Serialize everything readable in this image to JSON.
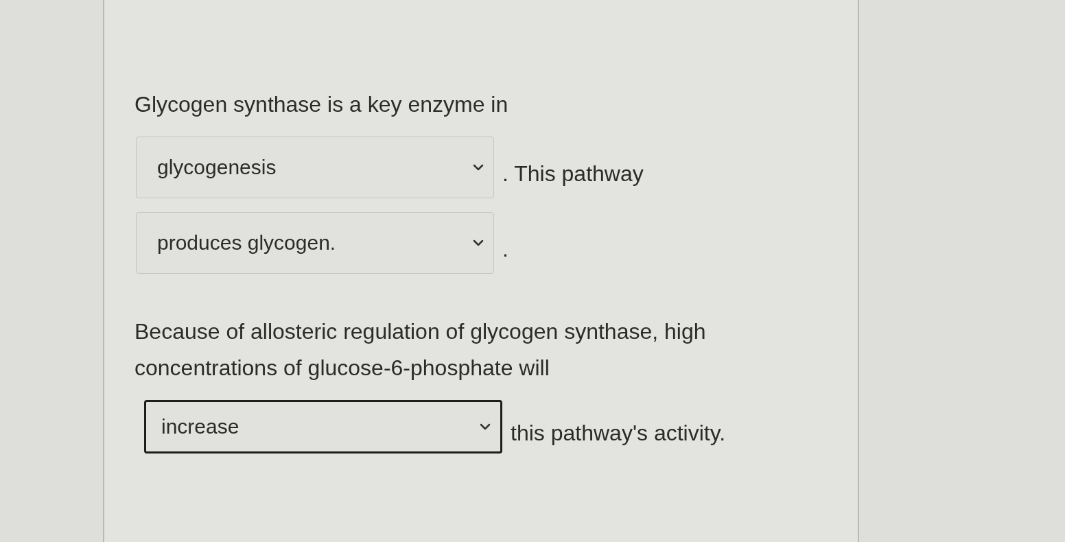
{
  "sentences": [
    {
      "segments": [
        {
          "kind": "text",
          "text": "Glycogen synthase is a key enzyme in"
        },
        {
          "kind": "dropdown",
          "value": "glycogenesis",
          "focused": false
        },
        {
          "kind": "text",
          "text": ". This pathway"
        },
        {
          "kind": "dropdown",
          "value": "produces glycogen.",
          "focused": false
        },
        {
          "kind": "text",
          "text": "."
        }
      ]
    },
    {
      "segments": [
        {
          "kind": "text",
          "text": "Because of allosteric regulation of glycogen synthase, high concentrations of glucose-6-phosphate will"
        },
        {
          "kind": "dropdown",
          "value": "increase",
          "focused": true
        },
        {
          "kind": "text",
          "text": "this pathway's activity."
        }
      ]
    }
  ]
}
